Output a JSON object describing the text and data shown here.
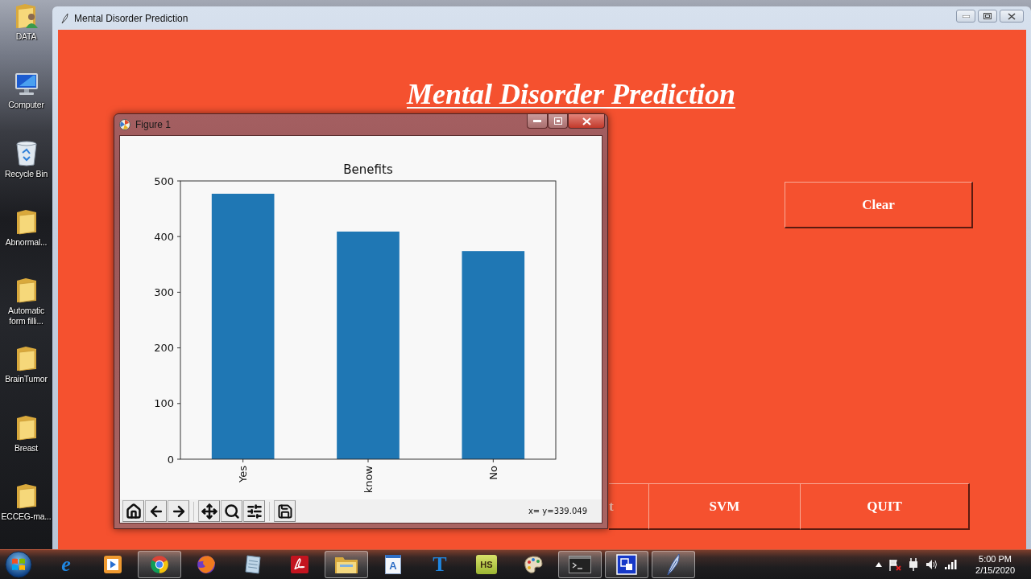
{
  "desktop": {
    "icons": [
      {
        "kind": "user-folder",
        "label": "DATA"
      },
      {
        "kind": "computer",
        "label": "Computer"
      },
      {
        "kind": "recycle-bin",
        "label": "Recycle Bin"
      },
      {
        "kind": "folder",
        "label": "Abnormal..."
      },
      {
        "kind": "folder",
        "label": "Automatic form filli..."
      },
      {
        "kind": "folder",
        "label": "BrainTumor"
      },
      {
        "kind": "folder",
        "label": "Breast"
      },
      {
        "kind": "folder",
        "label": "ECCEG-ma..."
      }
    ]
  },
  "main_window": {
    "title": "Mental Disorder Prediction",
    "heading": "Mental Disorder Prediction",
    "side_buttons": [
      "Clear"
    ],
    "bottom_buttons": [
      "t",
      "SVM",
      "QUIT"
    ]
  },
  "figure_window": {
    "title": "Figure 1",
    "chart_data": [
      {
        "type": "bar",
        "title": "Benefits",
        "categories": [
          "Yes",
          "know",
          "No"
        ],
        "values": [
          477,
          409,
          374
        ],
        "color": "#1f77b4",
        "ylim": [
          0,
          500
        ],
        "yticks": [
          0,
          100,
          200,
          300,
          400,
          500
        ]
      }
    ],
    "toolbar": [
      {
        "kind": "home"
      },
      {
        "kind": "back"
      },
      {
        "kind": "forward"
      },
      {
        "kind": "separator"
      },
      {
        "kind": "pan"
      },
      {
        "kind": "zoom"
      },
      {
        "kind": "configure"
      },
      {
        "kind": "separator"
      },
      {
        "kind": "save"
      }
    ],
    "status": "x= y=339.049"
  },
  "taskbar": {
    "apps": [
      {
        "kind": "letter-logo",
        "glyph": "e",
        "running": false
      },
      {
        "kind": "play-tile",
        "running": false
      },
      {
        "kind": "ring-logo",
        "running": true
      },
      {
        "kind": "globe",
        "running": false
      },
      {
        "kind": "notepad",
        "running": false
      },
      {
        "kind": "swirl-tile",
        "running": false
      },
      {
        "kind": "folder",
        "running": true
      },
      {
        "kind": "letter-document",
        "glyph": "A",
        "running": false
      },
      {
        "kind": "letter-tool",
        "glyph": "T",
        "running": false
      },
      {
        "kind": "letter-tile",
        "glyph": "HS",
        "running": false
      },
      {
        "kind": "palette",
        "running": false
      },
      {
        "kind": "terminal",
        "running": true
      },
      {
        "kind": "blue-square",
        "running": true
      },
      {
        "kind": "feather",
        "running": true
      }
    ],
    "clock": {
      "time": "5:00 PM",
      "date": "2/15/2020"
    }
  }
}
